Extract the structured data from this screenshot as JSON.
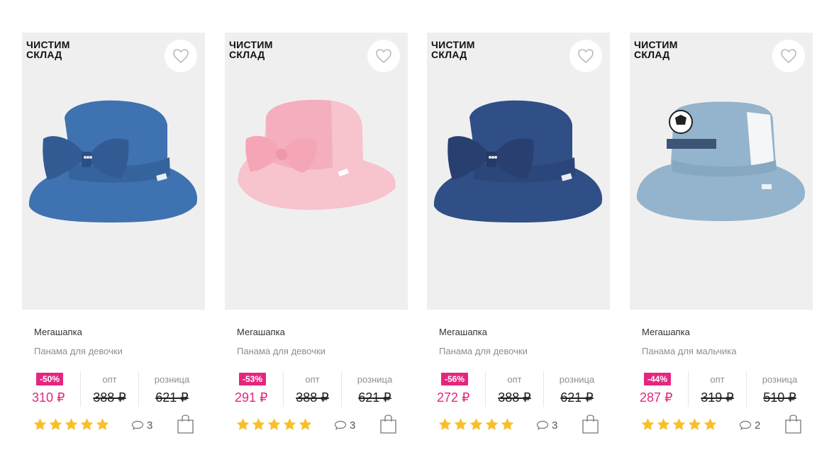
{
  "colors": {
    "accent": "#e4267f",
    "star": "#f7c02b"
  },
  "products": [
    {
      "promo_line1": "ЧИСТИМ",
      "promo_line2": "СКЛАД",
      "brand": "Мегашапка",
      "name": "Панама для девочки",
      "discount": "-50%",
      "price": "310 ₽",
      "opt_label": "опт",
      "opt_price": "388 ₽",
      "retail_label": "розница",
      "retail_price": "621 ₽",
      "rating": 5,
      "reviews": "3",
      "image": "blue-denim-bow-hat"
    },
    {
      "promo_line1": "ЧИСТИМ",
      "promo_line2": "СКЛАД",
      "brand": "Мегашапка",
      "name": "Панама для девочки",
      "discount": "-53%",
      "price": "291 ₽",
      "opt_label": "опт",
      "opt_price": "388 ₽",
      "retail_label": "розница",
      "retail_price": "621 ₽",
      "rating": 5,
      "reviews": "3",
      "image": "pink-lace-bow-hat"
    },
    {
      "promo_line1": "ЧИСТИМ",
      "promo_line2": "СКЛАД",
      "brand": "Мегашапка",
      "name": "Панама для девочки",
      "discount": "-56%",
      "price": "272 ₽",
      "opt_label": "опт",
      "opt_price": "388 ₽",
      "retail_label": "розница",
      "retail_price": "621 ₽",
      "rating": 5,
      "reviews": "3",
      "image": "dark-denim-bow-hat"
    },
    {
      "promo_line1": "ЧИСТИМ",
      "promo_line2": "СКЛАД",
      "brand": "Мегашапка",
      "name": "Панама для мальчика",
      "discount": "-44%",
      "price": "287 ₽",
      "opt_label": "опт",
      "opt_price": "319 ₽",
      "retail_label": "розница",
      "retail_price": "510 ₽",
      "rating": 5,
      "reviews": "2",
      "image": "light-blue-soccer-hat"
    }
  ]
}
